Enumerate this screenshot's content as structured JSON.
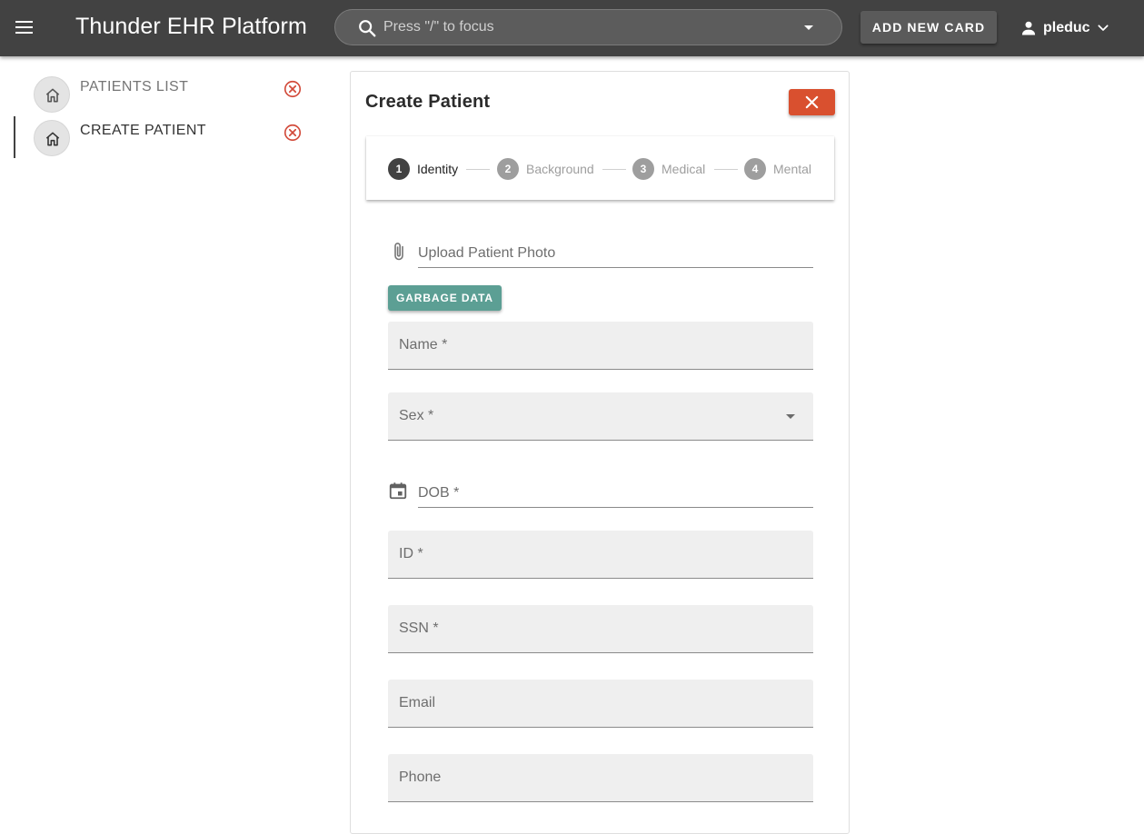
{
  "app": {
    "title": "Thunder EHR Platform",
    "search_placeholder": "Press \"/\" to focus",
    "add_card_label": "ADD NEW CARD",
    "user": "pleduc"
  },
  "sidebar": {
    "items": [
      {
        "label": "PATIENTS LIST",
        "icon": "home-icon",
        "active": false
      },
      {
        "label": "CREATE PATIENT",
        "icon": "home-icon",
        "active": true
      }
    ]
  },
  "card": {
    "title": "Create Patient",
    "steps": [
      {
        "num": "1",
        "label": "Identity",
        "active": true
      },
      {
        "num": "2",
        "label": "Background",
        "active": false
      },
      {
        "num": "3",
        "label": "Medical",
        "active": false
      },
      {
        "num": "4",
        "label": "Mental",
        "active": false
      }
    ],
    "upload_placeholder": "Upload Patient Photo",
    "garbage_label": "GARBAGE DATA",
    "fields": {
      "name": "Name *",
      "sex": "Sex *",
      "dob": "DOB *",
      "id": "ID *",
      "ssn": "SSN *",
      "email": "Email",
      "phone": "Phone"
    }
  },
  "colors": {
    "topbar": "#424242",
    "danger": "#d9502f",
    "teal": "#5c9f94",
    "field_bg": "#efefef"
  }
}
